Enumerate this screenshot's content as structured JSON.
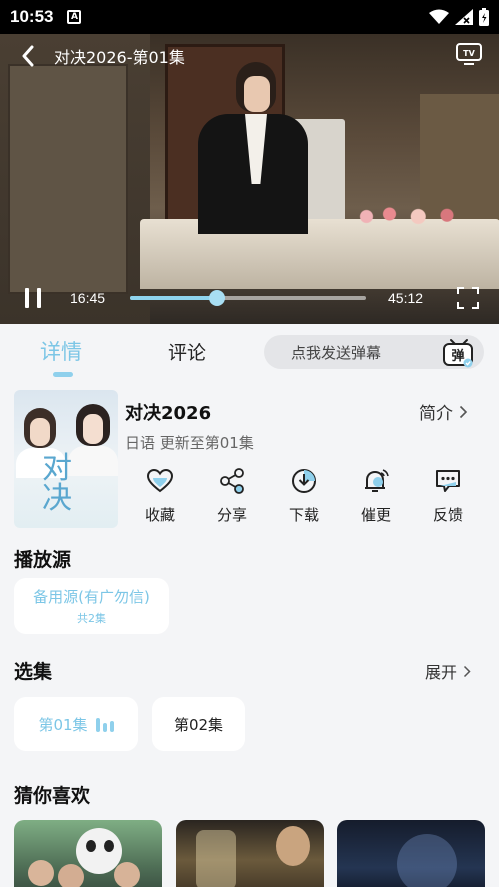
{
  "status_bar": {
    "time": "10:53",
    "notif_glyph": "A"
  },
  "player": {
    "title": "对决2026-第01集",
    "current_time": "16:45",
    "total_time": "45:12",
    "progress": 0.37
  },
  "tabs": {
    "details": "详情",
    "comments": "评论"
  },
  "danmaku": {
    "placeholder": "点我发送弹幕",
    "icon_text": "弹"
  },
  "show": {
    "poster_title": "对决",
    "title": "对决2026",
    "intro_label": "简介",
    "meta": "日语 更新至第01集"
  },
  "actions": [
    {
      "label": "收藏",
      "icon": "heart-icon"
    },
    {
      "label": "分享",
      "icon": "share-icon"
    },
    {
      "label": "下载",
      "icon": "download-icon"
    },
    {
      "label": "催更",
      "icon": "bell-icon"
    },
    {
      "label": "反馈",
      "icon": "feedback-icon"
    }
  ],
  "sources": {
    "section_title": "播放源",
    "name": "备用源(有广勿信)",
    "count": "共2集"
  },
  "episodes": {
    "section_title": "选集",
    "expand_label": "展开",
    "items": [
      "第01集",
      "第02集"
    ]
  },
  "recommend": {
    "section_title": "猜你喜欢"
  },
  "colors": {
    "accent": "#7cc6e6",
    "background": "#f4f5f7"
  }
}
